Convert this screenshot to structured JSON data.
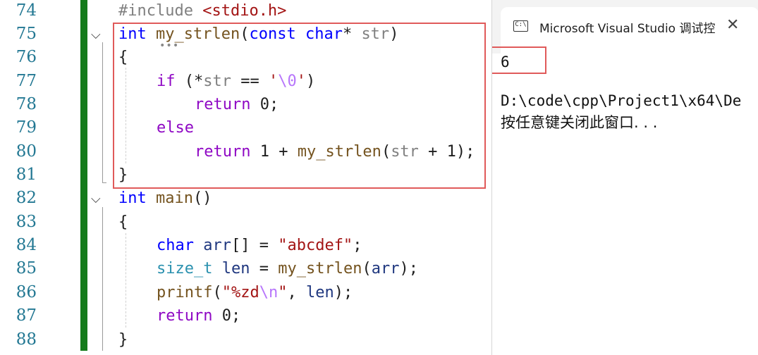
{
  "editor": {
    "line_numbers": [
      "74",
      "75",
      "76",
      "77",
      "78",
      "79",
      "80",
      "81",
      "82",
      "83",
      "84",
      "85",
      "86",
      "87",
      "88"
    ],
    "code": {
      "l74_include": "#include ",
      "l74_header": "<stdio.h>",
      "l75_int": "int",
      "l75_fn": "my_strlen",
      "l75_paren_open": "(",
      "l75_const": "const",
      "l75_char": "char",
      "l75_star": "*",
      "l75_param": "str",
      "l75_paren_close": ")",
      "l76_brace": "{",
      "l77_if": "if",
      "l77_open": " (*",
      "l77_str": "str",
      "l77_eq": " == ",
      "l77_q1": "'",
      "l77_esc": "\\0",
      "l77_q2": "'",
      "l77_close": ")",
      "l78_return": "return",
      "l78_rest": " 0;",
      "l79_else": "else",
      "l80_return": "return",
      "l80_plus": " 1 + ",
      "l80_fn": "my_strlen",
      "l80_open": "(",
      "l80_str": "str",
      "l80_rest": " + 1);",
      "l81_brace": "}",
      "l82_int": "int",
      "l82_main": "main",
      "l82_parens": "()",
      "l83_brace": "{",
      "l84_char": "char",
      "l84_arr": "arr",
      "l84_mid": "[] = ",
      "l84_str": "\"abcdef\"",
      "l84_semi": ";",
      "l85_type": "size_t",
      "l85_len": "len",
      "l85_eq": " = ",
      "l85_fn": "my_strlen",
      "l85_open": "(",
      "l85_arr": "arr",
      "l85_close": ");",
      "l86_fn": "printf",
      "l86_open": "(",
      "l86_str1": "\"%zd",
      "l86_esc": "\\n",
      "l86_str2": "\"",
      "l86_comma": ", ",
      "l86_len": "len",
      "l86_close": ");",
      "l87_return": "return",
      "l87_rest": " 0;",
      "l88_brace": "}"
    },
    "fold_icons": [
      "chevron-down-icon",
      "chevron-down-icon"
    ]
  },
  "console": {
    "tab_title": "Microsoft Visual Studio 调试控",
    "tab_icon_text": "C:\\",
    "close_glyph": "✕",
    "output_value": "6",
    "path_line": "D:\\code\\cpp\\Project1\\x64\\De",
    "prompt_line": "按任意键关闭此窗口. . ."
  },
  "colors": {
    "keyword": "#0000ff",
    "control": "#8f08c4",
    "string": "#a31515",
    "function": "#74531f",
    "type": "#2b91af",
    "highlight_box": "#e05a5a",
    "change_bar": "#157b1b"
  }
}
